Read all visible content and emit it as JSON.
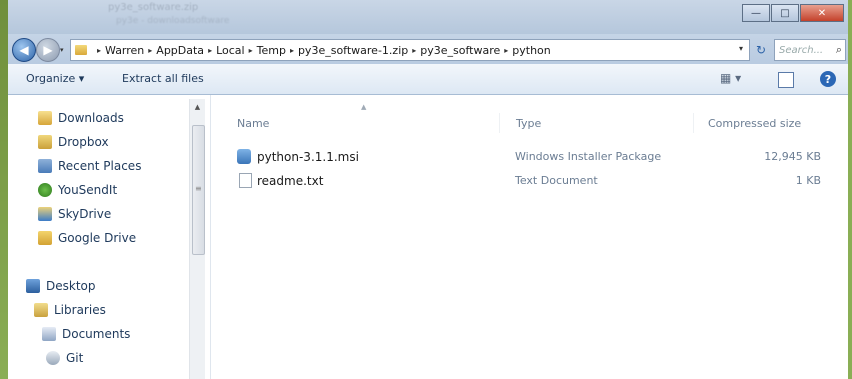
{
  "window": {
    "title_blur_1": "py3e_software.zip",
    "title_blur_2": "py3e - downloadsoftware",
    "minimize_label": "—",
    "maximize_label": "□",
    "close_label": "✕"
  },
  "navigation": {
    "back_glyph": "◀",
    "forward_glyph": "▶",
    "recent_glyph": "▾",
    "breadcrumbs": [
      "Warren",
      "AppData",
      "Local",
      "Temp",
      "py3e_software-1.zip",
      "py3e_software",
      "python"
    ],
    "refresh_glyph": "↻",
    "search_placeholder": "Search...",
    "search_icon_glyph": "⌕"
  },
  "toolbar": {
    "organize_label": "Organize ▾",
    "extract_label": "Extract all files",
    "views_glyph": "▦ ▾",
    "help_glyph": "?"
  },
  "sidebar": {
    "items": [
      {
        "label": "Downloads",
        "icon": "folder-downloads-icon"
      },
      {
        "label": "Dropbox",
        "icon": "dropbox-icon"
      },
      {
        "label": "Recent Places",
        "icon": "recent-places-icon"
      },
      {
        "label": "YouSendIt",
        "icon": "yousendit-icon"
      },
      {
        "label": "SkyDrive",
        "icon": "skydrive-icon"
      },
      {
        "label": "Google Drive",
        "icon": "google-drive-icon"
      },
      {
        "label": "Desktop",
        "icon": "desktop-icon"
      },
      {
        "label": "Libraries",
        "icon": "libraries-icon"
      },
      {
        "label": "Documents",
        "icon": "documents-icon"
      },
      {
        "label": "Git",
        "icon": "git-icon"
      }
    ]
  },
  "columns": {
    "name": "Name",
    "type": "Type",
    "compressed_size": "Compressed size"
  },
  "files": [
    {
      "name": "python-3.1.1.msi",
      "type": "Windows Installer Package",
      "size": "12,945 KB",
      "icon": "msi-file-icon"
    },
    {
      "name": "readme.txt",
      "type": "Text Document",
      "size": "1 KB",
      "icon": "text-file-icon"
    }
  ]
}
